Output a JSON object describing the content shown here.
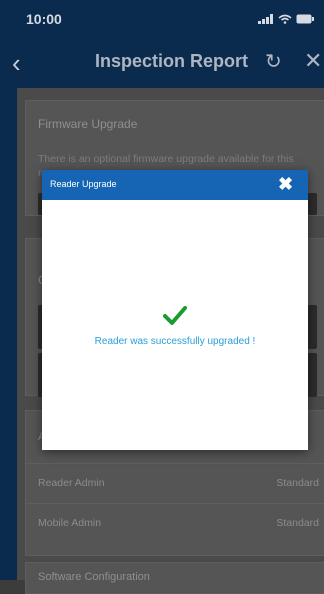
{
  "statusbar": {
    "time": "10:00"
  },
  "navbar": {
    "title": "Inspection Report"
  },
  "background": {
    "firmware_card": {
      "title": "Firmware Upgrade",
      "body": "There is an optional firmware upgrade available for this",
      "body_line2": "r"
    },
    "config_card": {
      "label": "C"
    },
    "admin_card": {
      "title": "A",
      "rows": [
        {
          "label": "Reader Admin",
          "value": "Standard"
        },
        {
          "label": "Mobile Admin",
          "value": "Standard"
        }
      ]
    },
    "software_card": {
      "title": "Software Configuration"
    }
  },
  "modal": {
    "title": "Reader Upgrade",
    "message": "Reader was successfully upgraded !",
    "accent": "#1665b5",
    "success_color": "#1a9b2f"
  }
}
